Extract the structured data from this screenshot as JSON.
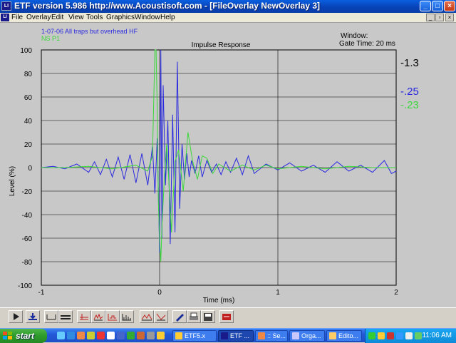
{
  "window": {
    "title": "ETF version 5.986 http://www.Acoustisoft.com - [FileOverlay NewOverlay 3]"
  },
  "menu": [
    "File",
    "Overlay",
    "Edit",
    "View",
    "Tools",
    "Graphics",
    "Window",
    "Help"
  ],
  "plot": {
    "legend": [
      {
        "name": "1-07-06 All traps but overhead HF",
        "color": "#2a2ae0"
      },
      {
        "name": "NS P1",
        "color": "#3ad83a"
      }
    ],
    "window_label": "Window:",
    "gate_label": "Gate Time: 20 ms",
    "readouts": [
      {
        "value": "-1.3",
        "color": "#000000"
      },
      {
        "value": "-.25",
        "color": "#2a2ae0"
      },
      {
        "value": "-.23",
        "color": "#3ad83a"
      }
    ]
  },
  "chart_data": {
    "type": "line",
    "title": "Impulse Response",
    "xlabel": "Time (ms)",
    "ylabel": "Level (%)",
    "xlim": [
      -1,
      2
    ],
    "ylim": [
      -100,
      100
    ],
    "x_ticks": [
      "-1",
      "0",
      "1",
      "2"
    ],
    "y_ticks": [
      "100",
      "80",
      "60",
      "40",
      "20",
      "0",
      "-20",
      "-40",
      "-60",
      "-80",
      "-100"
    ],
    "grid": true,
    "series": [
      {
        "name": "1-07-06 All traps but overhead HF",
        "color": "#2a2ae0",
        "x": [
          -1.0,
          -0.9,
          -0.8,
          -0.7,
          -0.6,
          -0.55,
          -0.5,
          -0.45,
          -0.4,
          -0.35,
          -0.3,
          -0.25,
          -0.2,
          -0.15,
          -0.1,
          -0.06,
          -0.04,
          -0.02,
          0.0,
          0.01,
          0.02,
          0.03,
          0.05,
          0.07,
          0.09,
          0.11,
          0.13,
          0.15,
          0.17,
          0.19,
          0.21,
          0.23,
          0.25,
          0.27,
          0.3,
          0.33,
          0.36,
          0.4,
          0.44,
          0.48,
          0.52,
          0.56,
          0.6,
          0.65,
          0.7,
          0.75,
          0.8,
          0.9,
          1.0,
          1.1,
          1.2,
          1.3,
          1.4,
          1.5,
          1.6,
          1.7,
          1.8,
          1.9,
          1.96,
          2.0
        ],
        "y": [
          0,
          1,
          -1,
          3,
          -4,
          5,
          -6,
          7,
          -8,
          9,
          -10,
          11,
          -13,
          12,
          -15,
          18,
          -22,
          25,
          -72,
          100,
          -60,
          70,
          -15,
          40,
          -65,
          45,
          -55,
          90,
          -35,
          20,
          -10,
          12,
          -8,
          6,
          -5,
          10,
          -8,
          6,
          -4,
          3,
          -6,
          5,
          -4,
          8,
          -6,
          10,
          -5,
          3,
          -2,
          4,
          -3,
          2,
          -4,
          5,
          -3,
          2,
          -4,
          6,
          -5,
          -3
        ]
      },
      {
        "name": "NS P1",
        "color": "#3ad83a",
        "x": [
          -1.0,
          -0.8,
          -0.6,
          -0.4,
          -0.2,
          -0.1,
          -0.06,
          -0.04,
          -0.03,
          -0.02,
          -0.01,
          0.0,
          0.01,
          0.02,
          0.04,
          0.06,
          0.08,
          0.1,
          0.13,
          0.16,
          0.2,
          0.24,
          0.28,
          0.32,
          0.36,
          0.4,
          0.45,
          0.5,
          0.6,
          0.7,
          0.8,
          0.9,
          1.0,
          1.2,
          1.4,
          1.6,
          1.8,
          2.0
        ],
        "y": [
          0,
          0,
          1,
          -1,
          2,
          -3,
          10,
          100,
          100,
          50,
          -30,
          -60,
          -80,
          -50,
          -10,
          20,
          -15,
          -55,
          5,
          15,
          -20,
          30,
          5,
          -10,
          10,
          8,
          -5,
          3,
          -3,
          2,
          -2,
          2,
          -1,
          1,
          -1,
          1,
          0,
          0
        ]
      }
    ]
  },
  "taskbar": {
    "start_label": "start",
    "tasks": [
      "ETF5.x",
      "ETF ...",
      ":: Se...",
      "Orga...",
      "Edito...",
      ""
    ],
    "clock": "11:06 AM"
  }
}
